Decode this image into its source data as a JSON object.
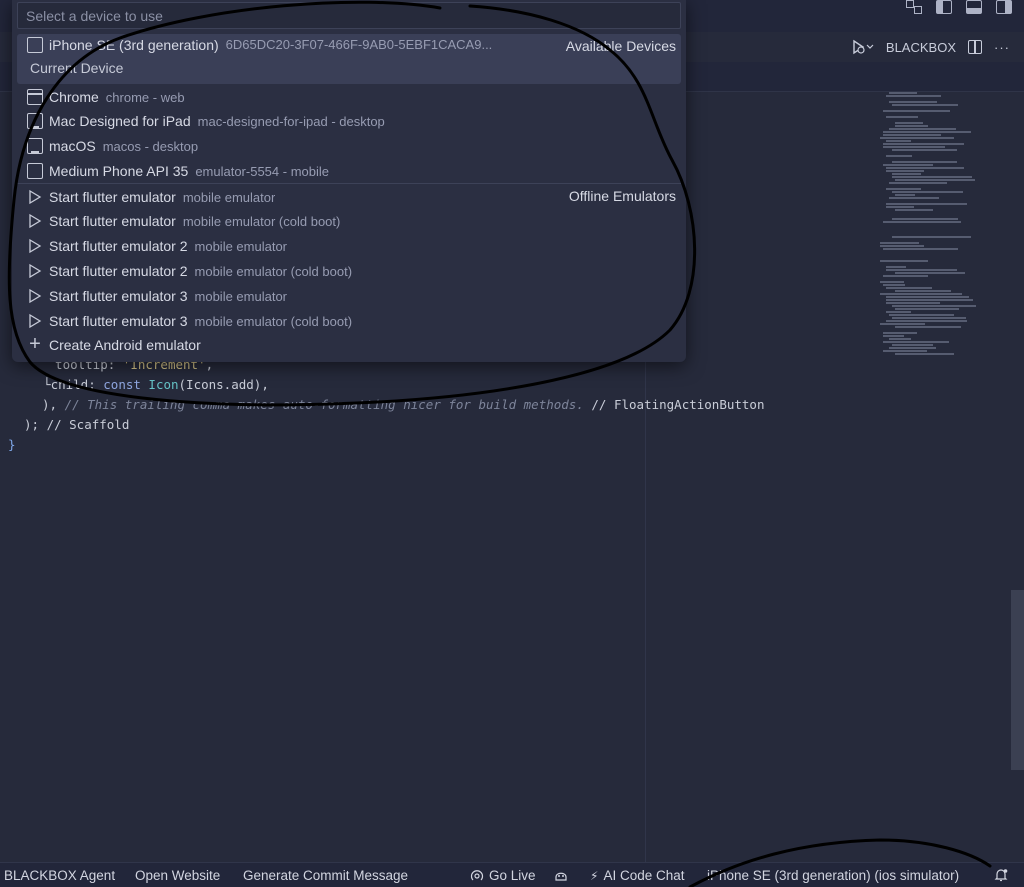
{
  "header": {
    "editor_actions": {
      "extension_label": "BLACKBOX"
    }
  },
  "quick_pick": {
    "placeholder": "Select a device to use",
    "groups": {
      "available": "Available Devices",
      "offline": "Offline Emulators"
    },
    "selected": {
      "label": "iPhone SE (3rd generation)",
      "description": "6D65DC20-3F07-466F-9AB0-5EBF1CACA9...",
      "detail": "Current Device"
    },
    "devices": [
      {
        "label": "Chrome",
        "description": "chrome - web",
        "icon": "browser-icon"
      },
      {
        "label": "Mac Designed for iPad",
        "description": "mac-designed-for-ipad - desktop",
        "icon": "monitor-icon"
      },
      {
        "label": "macOS",
        "description": "macos - desktop",
        "icon": "monitor-icon"
      },
      {
        "label": "Medium Phone API 35",
        "description": "emulator-5554 - mobile",
        "icon": "phone-icon"
      }
    ],
    "emulators": [
      {
        "label": "Start flutter emulator",
        "description": "mobile emulator"
      },
      {
        "label": "Start flutter emulator",
        "description": "mobile emulator (cold boot)"
      },
      {
        "label": "Start flutter emulator 2",
        "description": "mobile emulator"
      },
      {
        "label": "Start flutter emulator 2",
        "description": "mobile emulator (cold boot)"
      },
      {
        "label": "Start flutter emulator 3",
        "description": "mobile emulator"
      },
      {
        "label": "Start flutter emulator 3",
        "description": "mobile emulator (cold boot)"
      }
    ],
    "create": {
      "label": "Create Android emulator"
    }
  },
  "code": {
    "line1": {
      "pre": "  tooltip: ",
      "str": "'Increment'",
      "post": ","
    },
    "line2": {
      "pre": "  └child: ",
      "kw": "const ",
      "cls": "Icon",
      "rest": "(Icons.add),"
    },
    "line3": {
      "pre": "), ",
      "comment": "// This trailing comma makes auto-formatting nicer for build methods.",
      "tag": " // FloatingActionButton"
    },
    "line4": {
      "text": "); // Scaffold"
    },
    "line5": {
      "text": "}"
    }
  },
  "statusbar": {
    "agent": "BLACKBOX Agent",
    "website": "Open Website",
    "commit": "Generate Commit Message",
    "golive": "Go Live",
    "chat": "AI Code Chat",
    "device": "iPhone SE (3rd generation) (ios simulator)"
  }
}
